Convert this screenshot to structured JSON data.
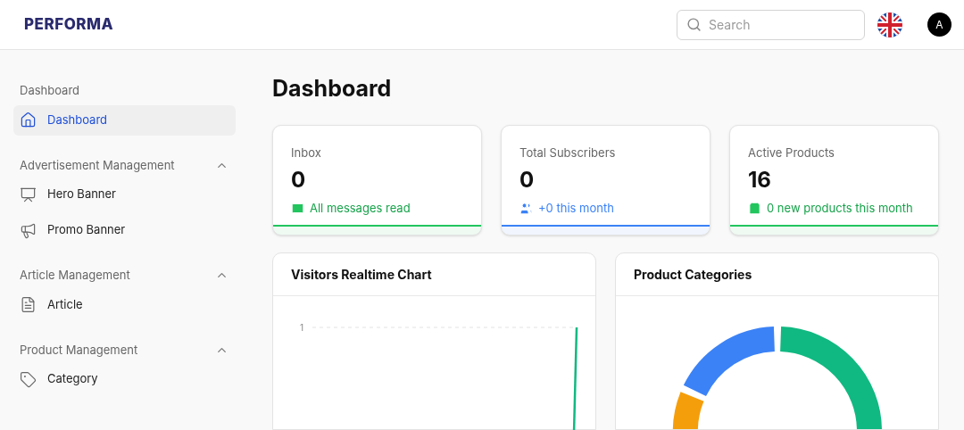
{
  "header": {
    "logo": "PERFORMA",
    "search": {
      "placeholder": "Search"
    },
    "avatar": "A"
  },
  "sidebar": {
    "sections": [
      {
        "title": "Dashboard",
        "kind": "plain",
        "items": [
          {
            "label": "Dashboard",
            "selected": true
          }
        ]
      },
      {
        "title": "Advertisement Management",
        "kind": "collapsible",
        "expanded": true,
        "items": [
          {
            "label": "Hero Banner",
            "selected": false
          },
          {
            "label": "Promo Banner",
            "selected": false
          }
        ]
      },
      {
        "title": "Article Management",
        "kind": "collapsible",
        "expanded": true,
        "items": [
          {
            "label": "Article",
            "selected": false
          }
        ]
      },
      {
        "title": "Product Management",
        "kind": "collapsible",
        "expanded": true,
        "items": [
          {
            "label": "Category",
            "selected": false
          }
        ]
      }
    ]
  },
  "page_title": "Dashboard",
  "stats": [
    {
      "label": "Inbox",
      "value": "0",
      "note": "All messages read",
      "color": "#22c55e"
    },
    {
      "label": "Total Subscribers",
      "value": "0",
      "note": "+0 this month",
      "color": "#3b82f6"
    },
    {
      "label": "Active Products",
      "value": "16",
      "note": "0 new products this month",
      "color": "#22c55e"
    }
  ],
  "visitors_chart": {
    "title": "Visitors Realtime Chart",
    "y_tick_label": "1"
  },
  "categories_chart": {
    "title": "Product Categories"
  }
}
